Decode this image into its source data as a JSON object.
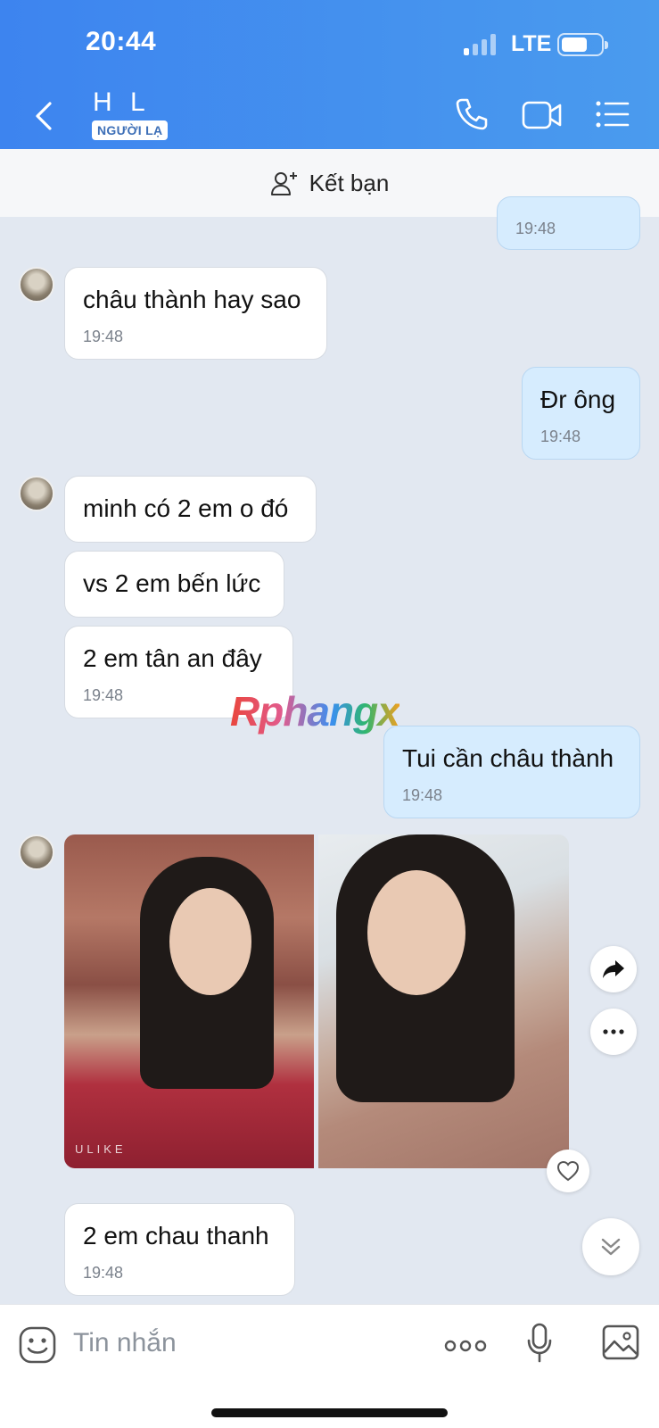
{
  "status_bar": {
    "time": "20:44",
    "network": "LTE"
  },
  "header": {
    "contact_name": "H L",
    "badge": "NGƯỜI LẠ",
    "icons": [
      "back-icon",
      "phone-icon",
      "video-call-icon",
      "menu-list-icon"
    ]
  },
  "friend_bar": {
    "label": "Kết bạn",
    "icon": "add-friend-icon"
  },
  "messages": [
    {
      "dir": "out",
      "text": "",
      "time": "19:48"
    },
    {
      "dir": "in",
      "text": "châu thành hay sao",
      "time": "19:48"
    },
    {
      "dir": "out",
      "text": "Đr ông",
      "time": "19:48"
    },
    {
      "dir": "in",
      "text": "minh có 2 em o đó",
      "time": ""
    },
    {
      "dir": "in",
      "text": "vs 2 em bến lức",
      "time": ""
    },
    {
      "dir": "in",
      "text": " 2 em tân an đây",
      "time": "19:48"
    },
    {
      "dir": "out",
      "text": "Tui cần châu thành",
      "time": "19:48"
    },
    {
      "dir": "in",
      "type": "photos",
      "photo_caption": "ULIKE"
    },
    {
      "dir": "in",
      "text": "2 em chau thanh",
      "time": "19:48"
    }
  ],
  "watermark": "Rphangx",
  "input_bar": {
    "placeholder": "Tin nhắn"
  }
}
